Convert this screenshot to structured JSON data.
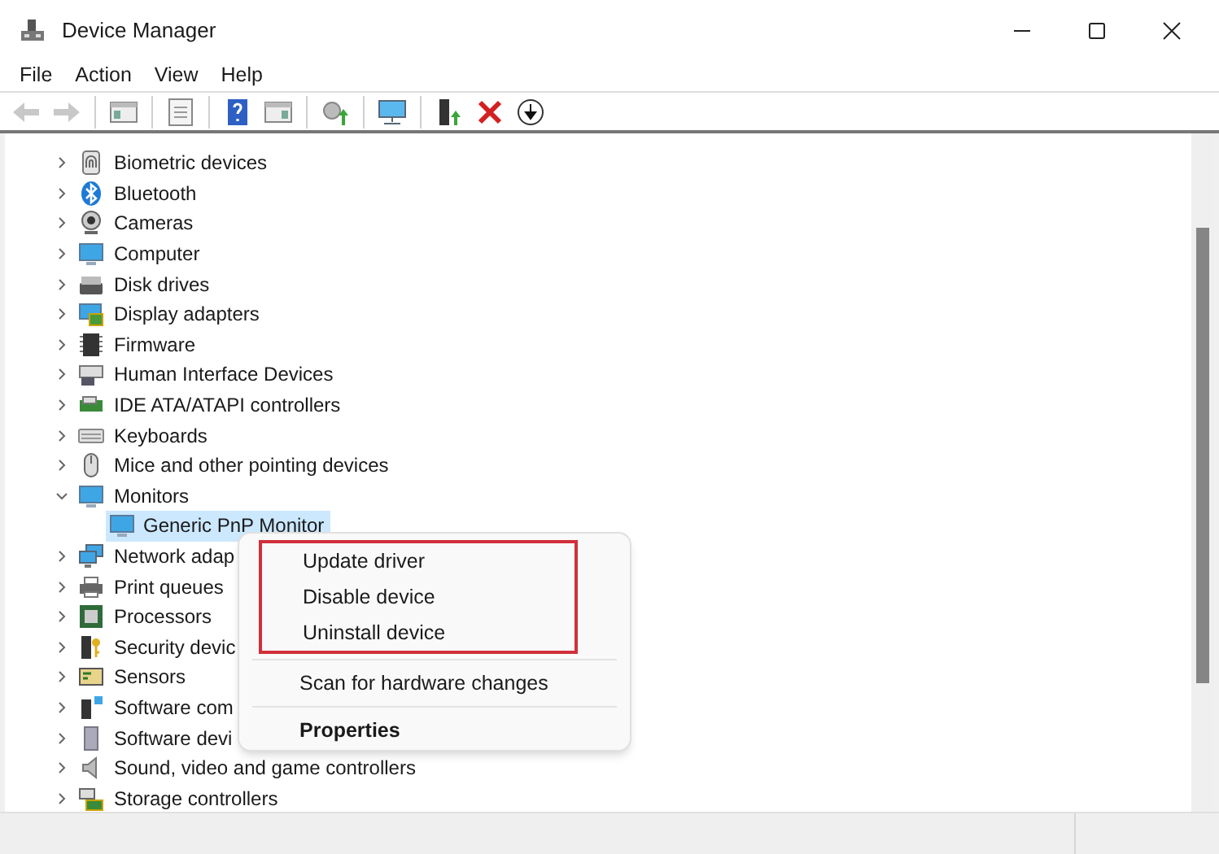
{
  "window": {
    "title": "Device Manager"
  },
  "menu_bar": [
    "File",
    "Action",
    "View",
    "Help"
  ],
  "toolbar": [
    {
      "kind": "back",
      "disabled": true
    },
    {
      "kind": "forward",
      "disabled": true
    },
    {
      "kind": "separator"
    },
    {
      "kind": "console",
      "disabled": false
    },
    {
      "kind": "separator"
    },
    {
      "kind": "properties",
      "disabled": false
    },
    {
      "kind": "separator"
    },
    {
      "kind": "help",
      "disabled": false
    },
    {
      "kind": "action-pane",
      "disabled": false
    },
    {
      "kind": "separator"
    },
    {
      "kind": "update",
      "disabled": false
    },
    {
      "kind": "separator"
    },
    {
      "kind": "scan",
      "disabled": false
    },
    {
      "kind": "separator"
    },
    {
      "kind": "enable",
      "disabled": false
    },
    {
      "kind": "uninstall",
      "disabled": false
    },
    {
      "kind": "download",
      "disabled": false
    }
  ],
  "tree": [
    {
      "label": "Biometric devices",
      "kind": "biometric",
      "expanded": false
    },
    {
      "label": "Bluetooth",
      "kind": "bluetooth",
      "expanded": false
    },
    {
      "label": "Cameras",
      "kind": "camera",
      "expanded": false
    },
    {
      "label": "Computer",
      "kind": "monitor",
      "expanded": false
    },
    {
      "label": "Disk drives",
      "kind": "disk",
      "expanded": false
    },
    {
      "label": "Display adapters",
      "kind": "display",
      "expanded": false
    },
    {
      "label": "Firmware",
      "kind": "chip",
      "expanded": false
    },
    {
      "label": "Human Interface Devices",
      "kind": "hid",
      "expanded": false
    },
    {
      "label": "IDE ATA/ATAPI controllers",
      "kind": "board",
      "expanded": false
    },
    {
      "label": "Keyboards",
      "kind": "keyboard",
      "expanded": false
    },
    {
      "label": "Mice and other pointing devices",
      "kind": "mouse",
      "expanded": false
    },
    {
      "label": "Monitors",
      "kind": "monitor",
      "expanded": true,
      "children": [
        {
          "label": "Generic PnP Monitor",
          "kind": "monitor",
          "selected": true
        }
      ]
    },
    {
      "label": "Network adap",
      "kind": "network",
      "expanded": false
    },
    {
      "label": "Print queues",
      "kind": "printer",
      "expanded": false
    },
    {
      "label": "Processors",
      "kind": "cpu",
      "expanded": false
    },
    {
      "label": "Security devic",
      "kind": "security",
      "expanded": false
    },
    {
      "label": "Sensors",
      "kind": "sensor",
      "expanded": false
    },
    {
      "label": "Software com",
      "kind": "component",
      "expanded": false
    },
    {
      "label": "Software devi",
      "kind": "tower",
      "expanded": false
    },
    {
      "label": "Sound, video and game controllers",
      "kind": "speaker",
      "expanded": false
    },
    {
      "label": "Storage controllers",
      "kind": "storage",
      "expanded": false
    }
  ],
  "context_menu": [
    {
      "kind": "item",
      "label": "Update driver",
      "highlighted": true,
      "default": false
    },
    {
      "kind": "item",
      "label": "Disable device",
      "highlighted": true,
      "default": false
    },
    {
      "kind": "item",
      "label": "Uninstall device",
      "highlighted": true,
      "default": false
    },
    {
      "kind": "separator"
    },
    {
      "kind": "item",
      "label": "Scan for hardware changes",
      "highlighted": false,
      "default": false
    },
    {
      "kind": "separator"
    },
    {
      "kind": "item",
      "label": "Properties",
      "highlighted": false,
      "default": true
    }
  ]
}
